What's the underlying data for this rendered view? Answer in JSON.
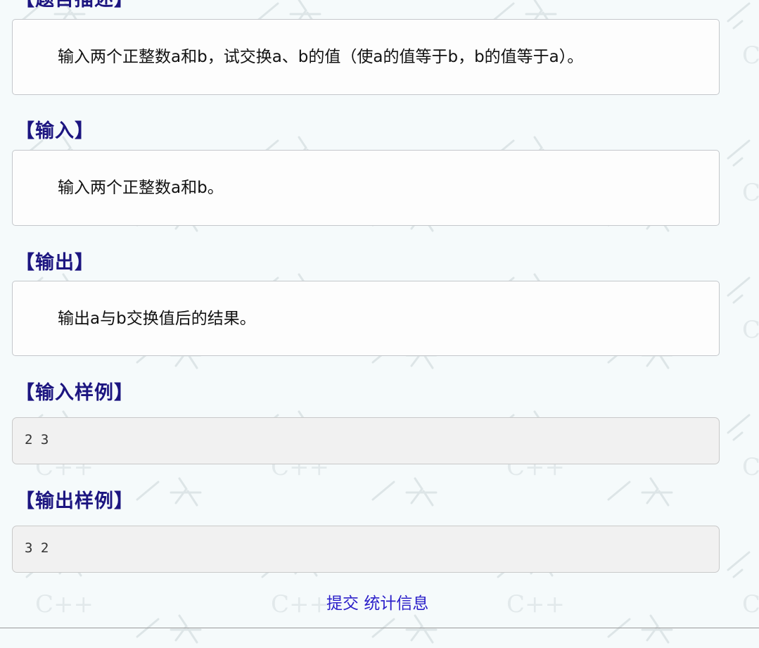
{
  "problem": {
    "description_title": "【题目描述】",
    "description_text": "输入两个正整数a和b，试交换a、b的值（使a的值等于b，b的值等于a）。",
    "input_title": "【输入】",
    "input_text": "输入两个正整数a和b。",
    "output_title": "【输出】",
    "output_text": "输出a与b交换值后的结果。",
    "sample_input_title": "【输入样例】",
    "sample_input": "2 3",
    "sample_output_title": "【输出样例】",
    "sample_output": "3 2"
  },
  "actions": {
    "submit_label": "提交",
    "stats_label": "统计信息"
  },
  "watermark": {
    "text": "C++"
  },
  "colors": {
    "section_title": "#1c1580",
    "link": "#2a1ec9",
    "page_background": "#f5fafb"
  }
}
